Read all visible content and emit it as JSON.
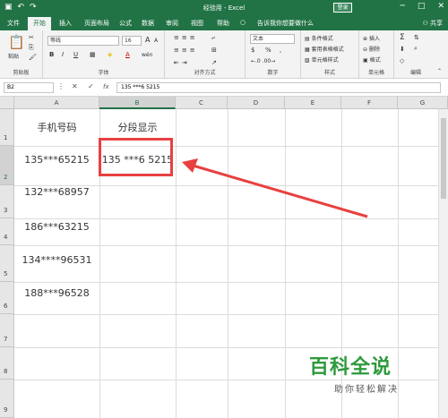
{
  "window": {
    "title": "经验用 - Excel",
    "login_label": "登录",
    "minimize": "─",
    "restore": "□",
    "close": "✕"
  },
  "tabs": [
    "文件",
    "开始",
    "插入",
    "页面布局",
    "公式",
    "数据",
    "审阅",
    "视图",
    "帮助"
  ],
  "tell_me": "告诉我你想要做什么",
  "share_label": "共享",
  "ribbon": {
    "clipboard": {
      "paste": "粘贴",
      "label": "剪贴板"
    },
    "font": {
      "name": "等线",
      "size": "16",
      "label": "字体",
      "bold": "B",
      "italic": "I",
      "underline": "U",
      "grow": "A",
      "shrink": "A",
      "color": "A",
      "wen": "wén"
    },
    "alignment": {
      "label": "对齐方式"
    },
    "number": {
      "format": "文本",
      "percent": "%",
      "comma": ",",
      "label": "数字"
    },
    "styles": {
      "conditional": "条件格式",
      "table": "套用表格格式",
      "cell_styles": "单元格样式",
      "label": "样式"
    },
    "cells": {
      "insert": "插入",
      "delete": "删除",
      "format": "格式",
      "label": "单元格"
    },
    "editing": {
      "label": "编辑"
    }
  },
  "formula_bar": {
    "name_box": "B2",
    "fx": "fx",
    "cancel": "✕",
    "enter": "✓",
    "content": "135 ***6 5215"
  },
  "sheet": {
    "columns": [
      "A",
      "B",
      "C",
      "D",
      "E",
      "F",
      "G"
    ],
    "rows": [
      "1",
      "2",
      "3",
      "4",
      "5",
      "6",
      "7",
      "8",
      "9"
    ],
    "header_a": "手机号码",
    "header_b": "分段显示",
    "phones": [
      "135***65215",
      "132***68957",
      "186***63215",
      "134****96531",
      "188***96528"
    ],
    "b2": "135 ***6 5215"
  },
  "watermark": {
    "title": "百科全说",
    "subtitle": "助你轻松解决"
  },
  "colors": {
    "excel_green": "#217346",
    "highlight_red": "#e84040",
    "watermark_green": "#2e9a3c"
  }
}
